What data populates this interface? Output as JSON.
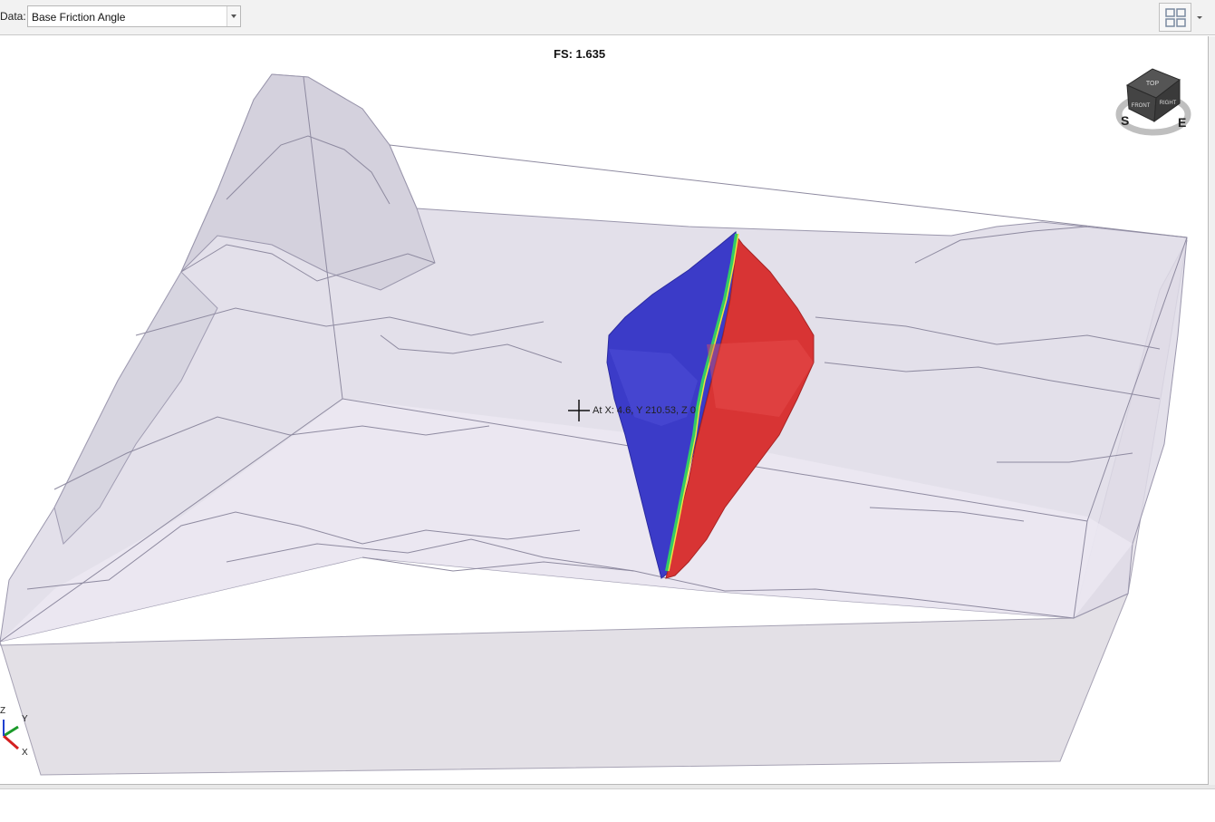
{
  "toolbar": {
    "data_label": "Data:",
    "data_value": "Base Friction Angle",
    "layout_icon": "grid-layout-icon"
  },
  "viewport": {
    "fs_text": "FS: 1.635",
    "cursor_readout": "At X: 4.6, Y 210.53, Z 0"
  },
  "navcube": {
    "face_top": "TOP",
    "face_front": "FRONT",
    "face_right": "RIGHT",
    "compass_s": "S",
    "compass_e": "E"
  },
  "axes": {
    "z": "Z",
    "y": "Y",
    "x": "X"
  },
  "colors": {
    "terrain_fill": "#dcd8e4",
    "terrain_edge": "#8e8aa0",
    "block_blue": "#3333cc",
    "block_red": "#d93030",
    "interface_green": "#33cc66"
  }
}
